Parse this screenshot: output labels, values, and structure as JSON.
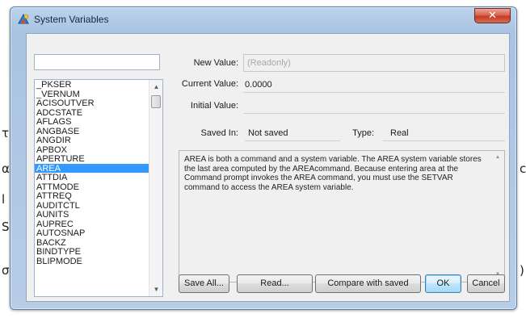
{
  "background_fragments": {
    "left_1": "τ",
    "left_2": "α",
    "left_3": "l",
    "left_4": "S",
    "left_5": "σ",
    "right_1": "c",
    "right_2": ")"
  },
  "window": {
    "title": "System Variables",
    "close_glyph": "✕"
  },
  "search": {
    "value": "",
    "placeholder": ""
  },
  "variable_list": {
    "items": [
      "_PKSER",
      "_VERNUM",
      "ACISOUTVER",
      "ADCSTATE",
      "AFLAGS",
      "ANGBASE",
      "ANGDIR",
      "APBOX",
      "APERTURE",
      "AREA",
      "ATTDIA",
      "ATTMODE",
      "ATTREQ",
      "AUDITCTL",
      "AUNITS",
      "AUPREC",
      "AUTOSNAP",
      "BACKZ",
      "BINDTYPE",
      "BLIPMODE"
    ],
    "selected": "AREA",
    "scroll_up_glyph": "▲",
    "scroll_down_glyph": "▼"
  },
  "fields": {
    "new_value_label": "New Value:",
    "new_value": "(Readonly)",
    "current_value_label": "Current Value:",
    "current_value": "0.0000",
    "initial_value_label": "Initial Value:",
    "initial_value": "",
    "saved_in_label": "Saved In:",
    "saved_in": "Not saved",
    "type_label": "Type:",
    "type": "Real"
  },
  "description": {
    "text": "AREA is both a command and a system variable. The AREA system variable stores the last area computed by the AREAcommand. Because entering area at the Command prompt invokes the AREA command, you must use the SETVAR command to access the AREA system variable.",
    "scroll_up_glyph": "▲",
    "scroll_down_glyph": "▼"
  },
  "buttons": {
    "save_all": "Save All...",
    "read": "Read...",
    "compare": "Compare with saved",
    "ok": "OK",
    "cancel": "Cancel"
  },
  "colors": {
    "selection": "#3399ff",
    "close_button": "#c63c26",
    "frame": "#a9c3e2"
  },
  "icons": {
    "title_icon": "autocad-app-icon",
    "close_icon": "close-icon"
  }
}
